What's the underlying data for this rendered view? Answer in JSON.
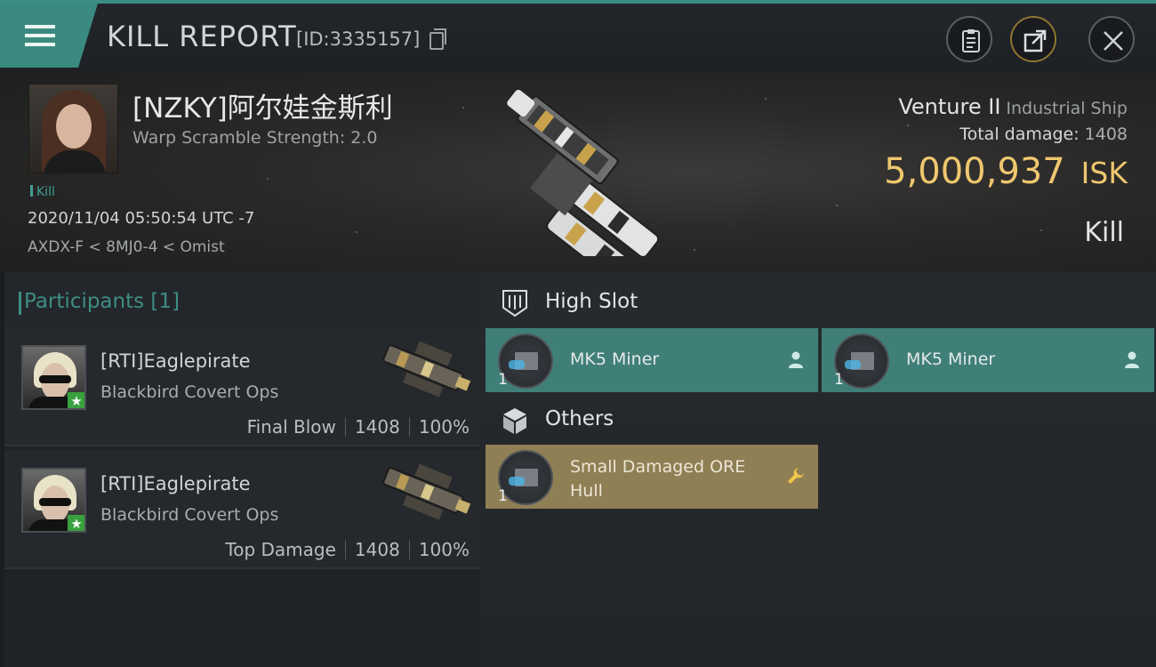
{
  "header": {
    "title": "KILL REPORT",
    "id_label": "[ID:3335157]",
    "menu_icon": "menu-icon",
    "icons": [
      "clipboard-icon",
      "share-icon",
      "close-icon"
    ]
  },
  "victim": {
    "name": "[NZKY]阿尔娃金斯利",
    "warp_scramble": "Warp Scramble Strength: 2.0",
    "tag": "Kill",
    "datetime": "2020/11/04 05:50:54 UTC -7",
    "location": "AXDX-F < 8MJ0-4 < Omist",
    "ship_name": "Venture II",
    "ship_class": "Industrial Ship",
    "total_damage_label": "Total damage:",
    "total_damage_value": "1408",
    "isk_value": "5,000,937",
    "isk_unit": "ISK",
    "result": "Kill"
  },
  "participants": {
    "title": "Participants",
    "count": "[1]",
    "rows": [
      {
        "name": "[RTI]Eaglepirate",
        "ship": "Blackbird Covert Ops",
        "role": "Final Blow",
        "damage": "1408",
        "percent": "100%"
      },
      {
        "name": "[RTI]Eaglepirate",
        "ship": "Blackbird Covert Ops",
        "role": "Top Damage",
        "damage": "1408",
        "percent": "100%"
      }
    ]
  },
  "high_slot": {
    "title": "High Slot",
    "items": [
      {
        "label": "MK5 Miner",
        "qty": "1"
      },
      {
        "label": "MK5 Miner",
        "qty": "1"
      }
    ]
  },
  "others": {
    "title": "Others",
    "items": [
      {
        "label": "Small Damaged ORE Hull",
        "qty": "1"
      }
    ]
  },
  "colors": {
    "accent_teal": "#3f7f78",
    "isk_gold": "#efc76e",
    "others_gold": "#8f7f55"
  }
}
